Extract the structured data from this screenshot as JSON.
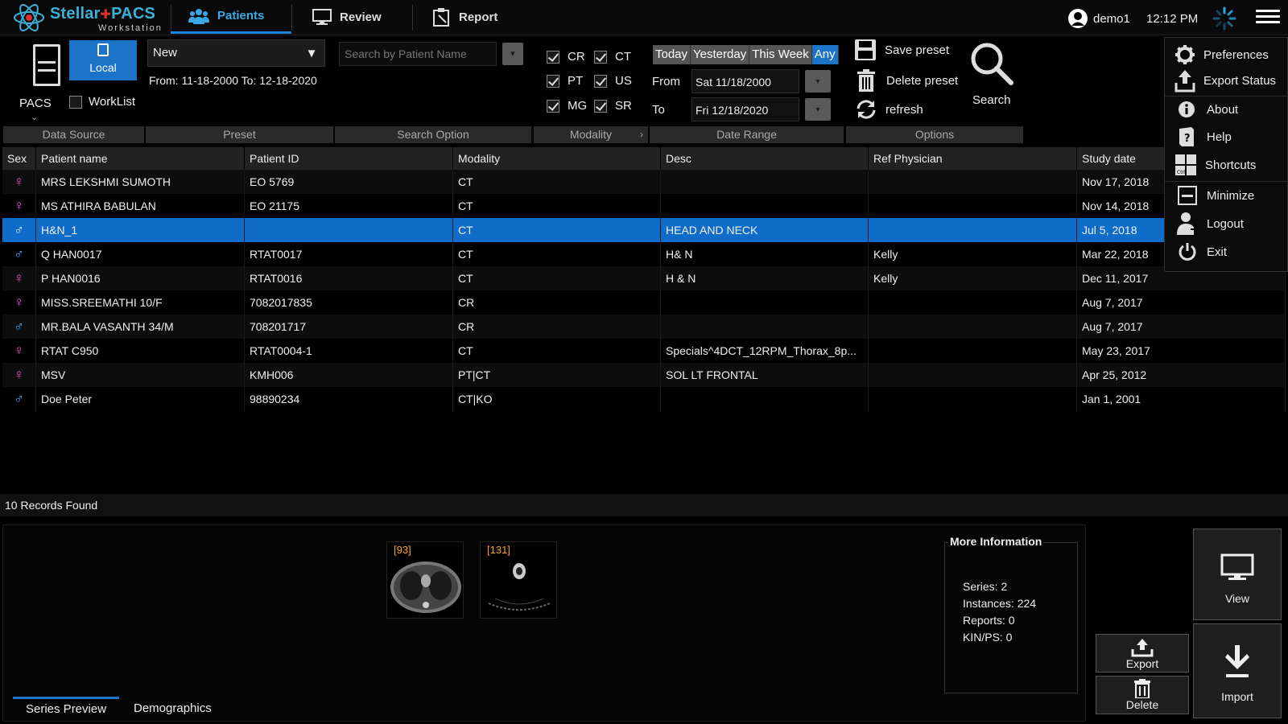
{
  "app": {
    "name": "Stellar",
    "name2": "PACS",
    "subtitle": "Workstation"
  },
  "nav": {
    "tabs": [
      {
        "label": "Patients",
        "icon": "patients-icon",
        "active": true
      },
      {
        "label": "Review",
        "icon": "monitor-icon"
      },
      {
        "label": "Report",
        "icon": "report-icon"
      }
    ],
    "user": "demo1",
    "time": "12:12 PM"
  },
  "toolbar": {
    "data_source": {
      "pacs_label": "PACS",
      "local_label": "Local",
      "worklist_label": "WorkList",
      "worklist_checked": false,
      "group_label": "Data Source"
    },
    "preset": {
      "selected": "New",
      "range_text": "From: 11-18-2000 To: 12-18-2020",
      "group_label": "Preset"
    },
    "search_option": {
      "placeholder": "Search by Patient Name",
      "group_label": "Search Option"
    },
    "modality": {
      "items": [
        {
          "label": "CR",
          "checked": true
        },
        {
          "label": "CT",
          "checked": true
        },
        {
          "label": "PT",
          "checked": true
        },
        {
          "label": "US",
          "checked": true
        },
        {
          "label": "MG",
          "checked": true
        },
        {
          "label": "SR",
          "checked": true
        }
      ],
      "group_label": "Modality"
    },
    "date_range": {
      "tabs": [
        "Today",
        "Yesterday",
        "This Week",
        "Any"
      ],
      "active_tab": "Any",
      "from_label": "From",
      "from_value": "Sat 11/18/2000",
      "to_label": "To",
      "to_value": "Fri 12/18/2020",
      "group_label": "Date Range"
    },
    "options": {
      "save_preset": "Save preset",
      "delete_preset": "Delete preset",
      "refresh": "refresh",
      "group_label": "Options"
    },
    "search_label": "Search"
  },
  "menu": {
    "items": [
      {
        "label": "Preferences",
        "icon": "gear-icon"
      },
      {
        "label": "Export Status",
        "icon": "upload-icon"
      },
      {
        "label": "About",
        "icon": "info-icon"
      },
      {
        "label": "Help",
        "icon": "help-book-icon"
      },
      {
        "label": "Shortcuts",
        "icon": "keyboard-icon"
      },
      {
        "label": "Minimize",
        "icon": "minimize-icon"
      },
      {
        "label": "Logout",
        "icon": "logout-user-icon"
      },
      {
        "label": "Exit",
        "icon": "power-icon"
      }
    ]
  },
  "table": {
    "columns": [
      "Sex",
      "Patient name",
      "Patient ID",
      "Modality",
      "Desc",
      "Ref Physician",
      "Study date"
    ],
    "rows": [
      {
        "sex": "F",
        "name": "MRS LEKSHMI SUMOTH",
        "id": "EO 5769",
        "modality": "CT",
        "desc": "",
        "physician": "",
        "date": "Nov 17, 2018"
      },
      {
        "sex": "F",
        "name": "MS ATHIRA BABULAN",
        "id": "EO 21175",
        "modality": "CT",
        "desc": "",
        "physician": "",
        "date": "Nov 14, 2018"
      },
      {
        "sex": "M",
        "name": "H&N_1",
        "id": "",
        "modality": "CT",
        "desc": "HEAD AND NECK",
        "physician": "",
        "date": "Jul 5, 2018",
        "selected": true
      },
      {
        "sex": "M",
        "name": "Q HAN0017",
        "id": "RTAT0017",
        "modality": "CT",
        "desc": "H& N",
        "physician": "Kelly",
        "date": "Mar 22, 2018"
      },
      {
        "sex": "F",
        "name": "P HAN0016",
        "id": "RTAT0016",
        "modality": "CT",
        "desc": "H & N",
        "physician": "Kelly",
        "date": "Dec 11, 2017"
      },
      {
        "sex": "F",
        "name": "MISS.SREEMATHI 10/F",
        "id": "7082017835",
        "modality": "CR",
        "desc": "",
        "physician": "",
        "date": "Aug 7, 2017"
      },
      {
        "sex": "M",
        "name": "MR.BALA VASANTH 34/M",
        "id": "708201717",
        "modality": "CR",
        "desc": "",
        "physician": "",
        "date": "Aug 7, 2017"
      },
      {
        "sex": "F",
        "name": "RTAT  C950",
        "id": "RTAT0004-1",
        "modality": "CT",
        "desc": "Specials^4DCT_12RPM_Thorax_8p...",
        "physician": "",
        "date": "May 23, 2017"
      },
      {
        "sex": "F",
        "name": "MSV",
        "id": "KMH006",
        "modality": "PT|CT",
        "desc": "SOL LT FRONTAL",
        "physician": "",
        "date": "Apr 25, 2012"
      },
      {
        "sex": "M",
        "name": "Doe Peter",
        "id": "98890234",
        "modality": "CT|KO",
        "desc": "",
        "physician": "",
        "date": "Jan 1, 2001"
      }
    ],
    "status": "10 Records Found"
  },
  "bottom": {
    "thumbnails": [
      {
        "count": "[93]"
      },
      {
        "count": "[131]"
      }
    ],
    "more_info": {
      "title": "More Information",
      "series": "Series: 2",
      "instances": "Instances: 224",
      "reports": "Reports: 0",
      "kinps": "KIN/PS: 0"
    },
    "tabs": [
      "Series Preview",
      "Demographics"
    ],
    "buttons": {
      "export": "Export",
      "delete": "Delete",
      "view": "View",
      "import": "Import"
    }
  },
  "colors": {
    "accent": "#1b74c8",
    "female": "#ff4fc4",
    "male": "#44a8ff",
    "thumb_count": "#f5a623"
  }
}
